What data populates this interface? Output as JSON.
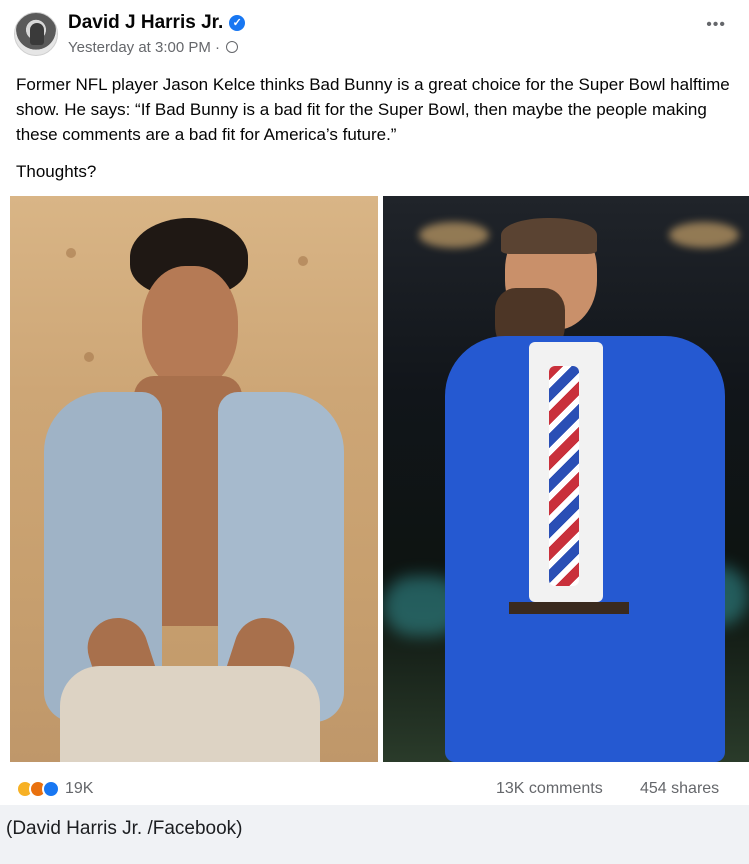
{
  "post": {
    "author": "David J Harris Jr.",
    "timestamp": "Yesterday at 3:00 PM",
    "separator": "·",
    "more_icon": "•••",
    "body": "Former NFL player Jason Kelce thinks Bad Bunny is a great choice for the Super Bowl halftime show. He says: “If Bad Bunny is a bad fit for the Super Bowl, then maybe the people making these comments are a bad fit for America’s future.”",
    "question": "Thoughts?"
  },
  "engagement": {
    "reaction_count": "19K",
    "comments": "13K comments",
    "shares": "454 shares",
    "reactions": [
      "haha-icon",
      "angry-icon",
      "like-icon"
    ]
  },
  "caption": "(David Harris Jr. /Facebook)",
  "colors": {
    "brand_blue": "#1877f2",
    "secondary_text": "#65676b"
  }
}
